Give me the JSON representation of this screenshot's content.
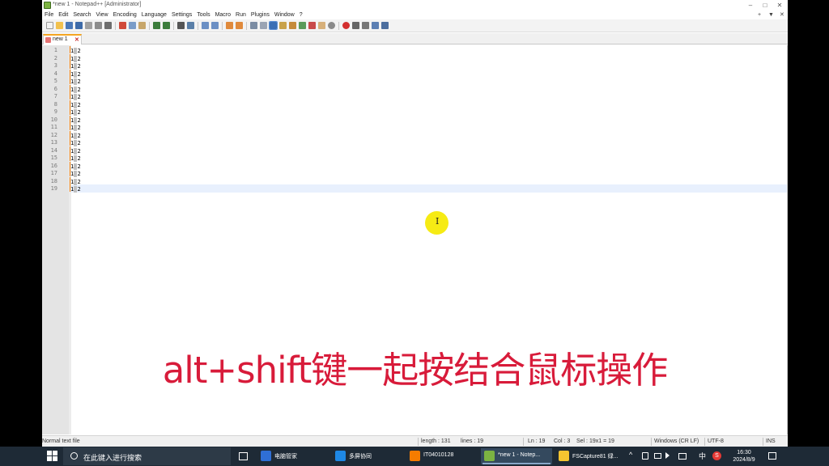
{
  "window": {
    "title": "*new 1 - Notepad++ [Administrator]",
    "controls": {
      "minimize": "–",
      "maximize": "□",
      "close": "✕"
    }
  },
  "menu": {
    "items": [
      "File",
      "Edit",
      "Search",
      "View",
      "Encoding",
      "Language",
      "Settings",
      "Tools",
      "Macro",
      "Run",
      "Plugins",
      "Window",
      "?"
    ],
    "right": {
      "add": "+",
      "down": "▼",
      "close": "✕"
    }
  },
  "tab": {
    "label": "new 1"
  },
  "editor": {
    "lines": [
      {
        "n": "1",
        "a": "1",
        "b": "2"
      },
      {
        "n": "2",
        "a": "1",
        "b": "2"
      },
      {
        "n": "3",
        "a": "1",
        "b": "2"
      },
      {
        "n": "4",
        "a": "1",
        "b": "2"
      },
      {
        "n": "5",
        "a": "1",
        "b": "2"
      },
      {
        "n": "6",
        "a": "1",
        "b": "2"
      },
      {
        "n": "7",
        "a": "1",
        "b": "2"
      },
      {
        "n": "8",
        "a": "1",
        "b": "2"
      },
      {
        "n": "9",
        "a": "1",
        "b": "2"
      },
      {
        "n": "10",
        "a": "1",
        "b": "2"
      },
      {
        "n": "11",
        "a": "1",
        "b": "2"
      },
      {
        "n": "12",
        "a": "1",
        "b": "2"
      },
      {
        "n": "13",
        "a": "1",
        "b": "2"
      },
      {
        "n": "14",
        "a": "1",
        "b": "2"
      },
      {
        "n": "15",
        "a": "1",
        "b": "2"
      },
      {
        "n": "16",
        "a": "1",
        "b": "2"
      },
      {
        "n": "17",
        "a": "1",
        "b": "2"
      },
      {
        "n": "18",
        "a": "1",
        "b": "2"
      },
      {
        "n": "19",
        "a": "1",
        "b": "2"
      }
    ],
    "mouse_cursor": "I",
    "caption": "alt+shift键一起按结合鼠标操作",
    "colors": {
      "caption": "#d81b3a",
      "cursor_highlight": "#f6eb14",
      "caret": "#f57c00"
    }
  },
  "status": {
    "file_type": "Normal text file",
    "length": "length : 131",
    "lines": "lines : 19",
    "ln": "Ln : 19",
    "col": "Col : 3",
    "sel": "Sel : 19x1 = 19",
    "eol": "Windows (CR LF)",
    "encoding": "UTF-8",
    "mode": "INS"
  },
  "taskbar": {
    "search_placeholder": "在此键入进行搜索",
    "apps": [
      {
        "label": "电脑管家",
        "color": "#2f6fd6"
      },
      {
        "label": "多屏协同",
        "color": "#1e88e5"
      },
      {
        "label": "IT04010128",
        "color": "#f57c00"
      },
      {
        "label": "*new 1 - Notep...",
        "color": "#7cb342"
      },
      {
        "label": "FSCapture81 绿...",
        "color": "#f4c430"
      }
    ],
    "tray": {
      "chevron": "^",
      "ime": "中",
      "app": "S"
    },
    "time": "16:30",
    "date": "2024/8/9"
  }
}
